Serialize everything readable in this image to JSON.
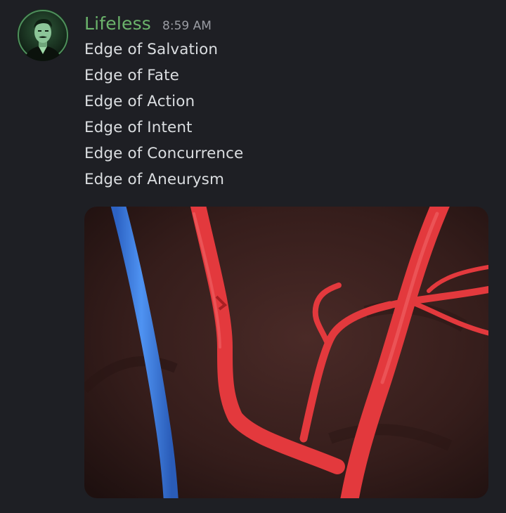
{
  "message": {
    "author": "Lifeless",
    "timestamp": "8:59 AM",
    "lines": [
      "Edge of Salvation",
      "Edge of Fate",
      "Edge of Action",
      "Edge of Intent",
      "Edge of Concurrence",
      "Edge of Aneurysm"
    ],
    "attachment_icon": "animated-artery-image"
  },
  "colors": {
    "background": "#1e1f24",
    "author": "#6bb36b",
    "text": "#dbdee1",
    "timestamp": "#9a9ca3",
    "artery": "#e3393d",
    "vein": "#3f80e6"
  }
}
